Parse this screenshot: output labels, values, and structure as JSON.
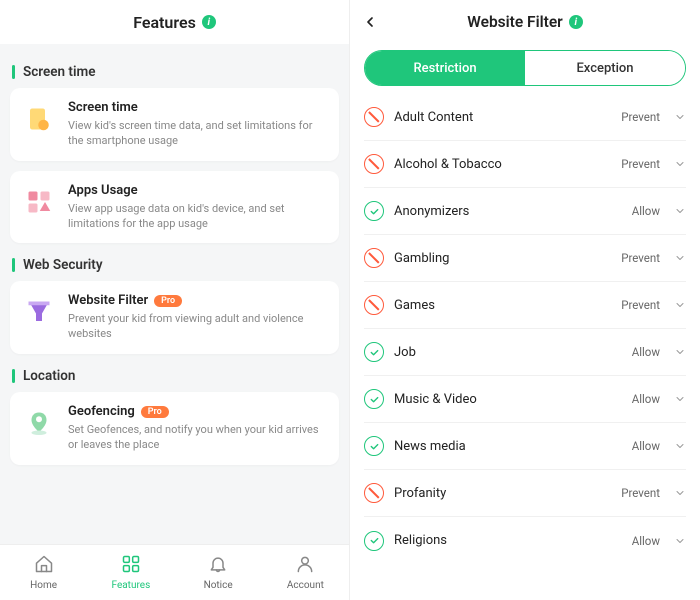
{
  "left": {
    "title": "Features",
    "sections": [
      {
        "heading": "Screen time",
        "cards": [
          {
            "title": "Screen time",
            "desc": "View kid's screen time data, and set limitations for the smartphone usage",
            "pro": false,
            "icon": "screen-time"
          },
          {
            "title": "Apps Usage",
            "desc": "View app usage data on kid's device, and set limitations for the app usage",
            "pro": false,
            "icon": "apps-usage"
          }
        ]
      },
      {
        "heading": "Web Security",
        "cards": [
          {
            "title": "Website Filter",
            "desc": "Prevent your kid from viewing adult and violence websites",
            "pro": true,
            "icon": "website-filter"
          }
        ]
      },
      {
        "heading": "Location",
        "cards": [
          {
            "title": "Geofencing",
            "desc": "Set Geofences, and notify you when your kid arrives or leaves the place",
            "pro": true,
            "icon": "geofencing"
          }
        ]
      }
    ],
    "pro_label": "Pro",
    "nav": [
      {
        "label": "Home",
        "icon": "home",
        "active": false
      },
      {
        "label": "Features",
        "icon": "features",
        "active": true
      },
      {
        "label": "Notice",
        "icon": "notice",
        "active": false
      },
      {
        "label": "Account",
        "icon": "account",
        "active": false
      }
    ]
  },
  "right": {
    "title": "Website Filter",
    "tabs": {
      "restriction": "Restriction",
      "exception": "Exception",
      "active": "restriction"
    },
    "action_labels": {
      "prevent": "Prevent",
      "allow": "Allow"
    },
    "categories": [
      {
        "name": "Adult Content",
        "action": "prevent"
      },
      {
        "name": "Alcohol & Tobacco",
        "action": "prevent"
      },
      {
        "name": "Anonymizers",
        "action": "allow"
      },
      {
        "name": "Gambling",
        "action": "prevent"
      },
      {
        "name": "Games",
        "action": "prevent"
      },
      {
        "name": "Job",
        "action": "allow"
      },
      {
        "name": "Music & Video",
        "action": "allow"
      },
      {
        "name": "News media",
        "action": "allow"
      },
      {
        "name": "Profanity",
        "action": "prevent"
      },
      {
        "name": "Religions",
        "action": "allow"
      }
    ]
  },
  "colors": {
    "accent": "#1fc67b",
    "danger": "#ff5a3c",
    "pro": "#ff7a3d"
  }
}
